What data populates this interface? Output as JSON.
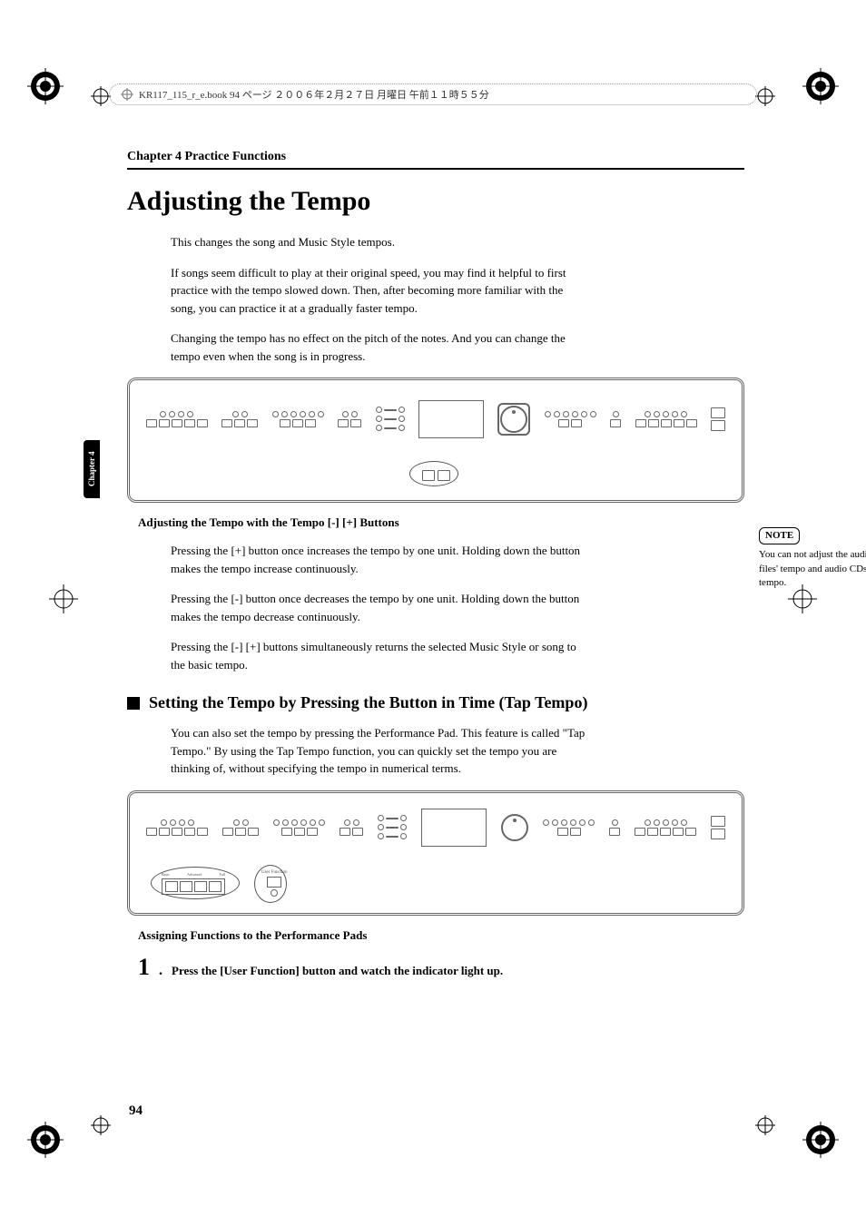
{
  "header_runner": "KR117_115_r_e.book 94 ページ ２００６年２月２７日 月曜日 午前１１時５５分",
  "chapter_heading": "Chapter 4 Practice Functions",
  "side_tab": "Chapter 4",
  "title": "Adjusting the Tempo",
  "intro": {
    "p1": "This changes the song and Music Style tempos.",
    "p2": "If songs seem difficult to play at their original speed, you may find it helpful to first practice with the tempo slowed down. Then, after becoming more familiar with the song, you can practice it at a gradually faster tempo.",
    "p3": "Changing the tempo has no effect on the pitch of the notes. And you can change the tempo even when the song is in progress."
  },
  "sub1": {
    "heading": "Adjusting the Tempo with the Tempo [-] [+] Buttons",
    "p1": "Pressing the [+] button once increases the tempo by one unit. Holding down the button makes the tempo increase continuously.",
    "p2": "Pressing the [-] button once decreases the tempo by one unit. Holding down the button makes the tempo decrease continuously.",
    "p3": "Pressing the [-] [+] buttons simultaneously returns the selected Music Style or song to the basic tempo."
  },
  "note": {
    "label": "NOTE",
    "text": "You can not adjust the audio files' tempo and audio CDs' tempo."
  },
  "section2": {
    "heading": "Setting the Tempo by Pressing the Button in Time (Tap Tempo)",
    "p1": "You can also set the tempo by pressing the Performance Pad. This feature is called \"Tap Tempo.\" By using the Tap Tempo function, you can quickly set the tempo you are thinking of, without specifying the tempo in numerical terms."
  },
  "sub2": {
    "heading": "Assigning Functions to the Performance Pads"
  },
  "step1": {
    "num": "1",
    "dot": ".",
    "text": "Press the [User Function] button and watch the indicator light up."
  },
  "pad_labels": {
    "l": "Basic",
    "m": "Advanced",
    "r": "Full"
  },
  "user_fn_label": "User Function",
  "page_number": "94"
}
